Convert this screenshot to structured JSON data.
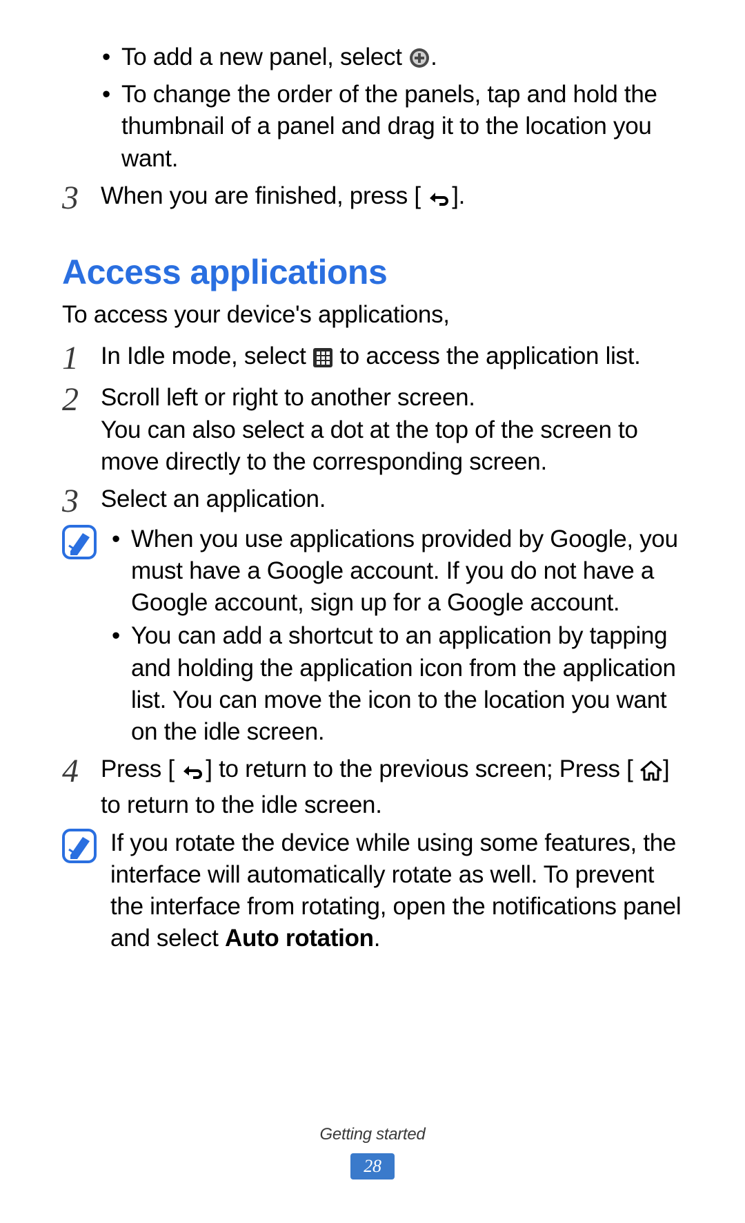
{
  "top": {
    "bullets": [
      {
        "pre": "To add a new panel, select ",
        "post": "."
      },
      {
        "text": "To change the order of the panels, tap and hold the thumbnail of a panel and drag it to the location you want."
      }
    ],
    "step3": {
      "num": "3",
      "pre": "When you are finished, press [",
      "post": "]."
    }
  },
  "heading": "Access applications",
  "intro": "To access your device's applications,",
  "steps": {
    "s1": {
      "num": "1",
      "pre": "In Idle mode, select ",
      "post": " to access the application list."
    },
    "s2": {
      "num": "2",
      "line1": "Scroll left or right to another screen.",
      "line2": "You can also select a dot at the top of the screen to move directly to the corresponding screen."
    },
    "s3": {
      "num": "3",
      "text": "Select an application."
    },
    "s4": {
      "num": "4",
      "pre": "Press [",
      "mid": "] to return to the previous screen; Press [",
      "post": "] to return to the idle screen."
    }
  },
  "note1": {
    "b1": "When you use applications provided by Google, you must have a Google account. If you do not have a Google account, sign up for a Google account.",
    "b2": "You can add a shortcut to an application by tapping and holding the application icon from the application list. You can move the icon to the location you want on the idle screen."
  },
  "note2": {
    "pre": "If you rotate the device while using some features, the interface will automatically rotate as well. To prevent the interface from rotating, open the notifications panel and select ",
    "bold": "Auto rotation",
    "post": "."
  },
  "footer": {
    "section": "Getting started",
    "page": "28"
  }
}
